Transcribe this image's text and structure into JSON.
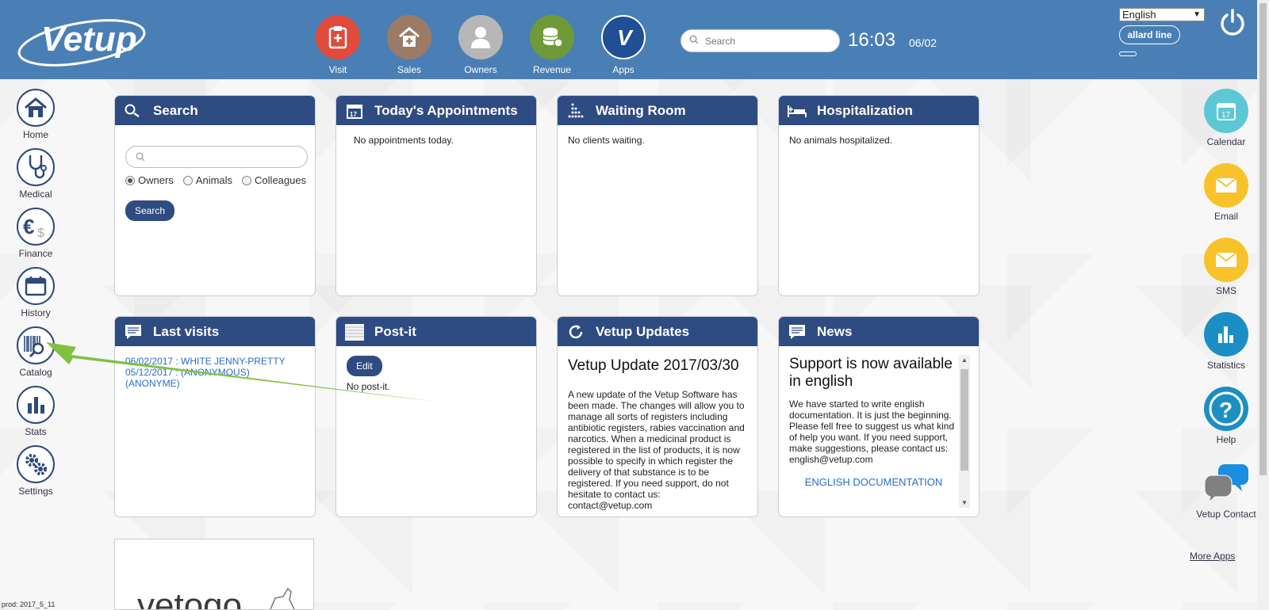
{
  "header": {
    "logo_text": "Vetup",
    "nav": [
      {
        "label": "Visit",
        "color": "#e14b3b"
      },
      {
        "label": "Sales",
        "color": "#9b7b66"
      },
      {
        "label": "Owners",
        "color": "#b7b7b7"
      },
      {
        "label": "Revenue",
        "color": "#6f9a37"
      },
      {
        "label": "Apps",
        "color": "#1f4f94"
      }
    ],
    "search_placeholder": "Search",
    "time": "16:03",
    "date": "06/02",
    "language": "English",
    "user": "allard line"
  },
  "left_nav": [
    {
      "label": "Home",
      "icon": "home-icon"
    },
    {
      "label": "Medical",
      "icon": "stethoscope-icon"
    },
    {
      "label": "Finance",
      "icon": "currency-icon"
    },
    {
      "label": "History",
      "icon": "calendar-history-icon"
    },
    {
      "label": "Catalog",
      "icon": "barcode-icon"
    },
    {
      "label": "Stats",
      "icon": "bar-chart-icon"
    },
    {
      "label": "Settings",
      "icon": "gears-icon"
    }
  ],
  "right_nav": [
    {
      "label": "Calendar",
      "color": "#5cc8d6"
    },
    {
      "label": "Email",
      "color": "#f8c22a"
    },
    {
      "label": "SMS",
      "color": "#f8c22a"
    },
    {
      "label": "Statistics",
      "color": "#1b8fc4"
    },
    {
      "label": "Help",
      "color": "#1b8fc4"
    },
    {
      "label": "Vetup Contact",
      "color": "#1a8fe0"
    }
  ],
  "more_apps": "More Apps",
  "panels": {
    "search": {
      "title": "Search",
      "radios": [
        "Owners",
        "Animals",
        "Colleagues"
      ],
      "selected": "Owners",
      "button": "Search"
    },
    "appointments": {
      "title": "Today's Appointments",
      "text": "No appointments today.",
      "icon_day": "17"
    },
    "waiting": {
      "title": "Waiting Room",
      "text": "No clients waiting."
    },
    "hospital": {
      "title": "Hospitalization",
      "text": "No animals hospitalized."
    },
    "last_visits": {
      "title": "Last visits",
      "rows": [
        "06/02/2017 : WHITE JENNY-PRETTY",
        "05/12/2017 : (ANONYMOUS) (ANONYME)"
      ]
    },
    "postit": {
      "title": "Post-it",
      "edit": "Edit",
      "text": "No post-it."
    },
    "updates": {
      "title": "Vetup Updates",
      "heading": "Vetup Update 2017/03/30",
      "body": "A new update of the Vetup Software has been made. The changes will allow you to manage all sorts of registers including antibiotic registers, rabies vaccination and narcotics. When a medicinal product is registered in the list of products, it is now possible to specify in which register the delivery of that substance is to be registered. If you need support, do not hesitate to contact us: contact@vetup.com"
    },
    "news": {
      "title": "News",
      "heading": "Support is now available in english",
      "body": "We have started to write english documentation. It is just the beginning. Please fell free to suggest us what kind of help you want. If you need support, make suggestions, please contact us: english@vetup.com",
      "link": "ENGLISH DOCUMENTATION"
    }
  },
  "vetogo_text": "vetogo",
  "version": "prod: 2017_5_11",
  "colors": {
    "header": "#4a7fb5",
    "panel_header": "#2f4c82",
    "arrow": "#7fc241"
  }
}
